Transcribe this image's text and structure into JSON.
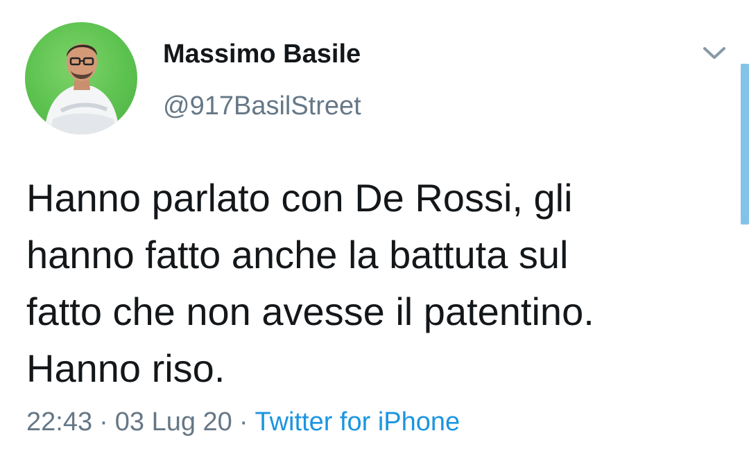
{
  "tweet": {
    "display_name": "Massimo Basile",
    "handle": "@917BasilStreet",
    "text": "Hanno parlato con De Rossi, gli\nhanno fatto anche la battuta sul\nfatto che non avesse il patentino.\nHanno riso.",
    "time": "22:43",
    "date": "03 Lug 20",
    "separator": "·",
    "source": "Twitter for iPhone"
  },
  "icons": {
    "menu": "chevron-down-icon",
    "avatar": "avatar"
  },
  "colors": {
    "text": "#14171a",
    "secondary": "#657786",
    "link": "#1b95e0",
    "avatar_bg": "#5cc24f",
    "scrollbar": "#82c4e9"
  }
}
